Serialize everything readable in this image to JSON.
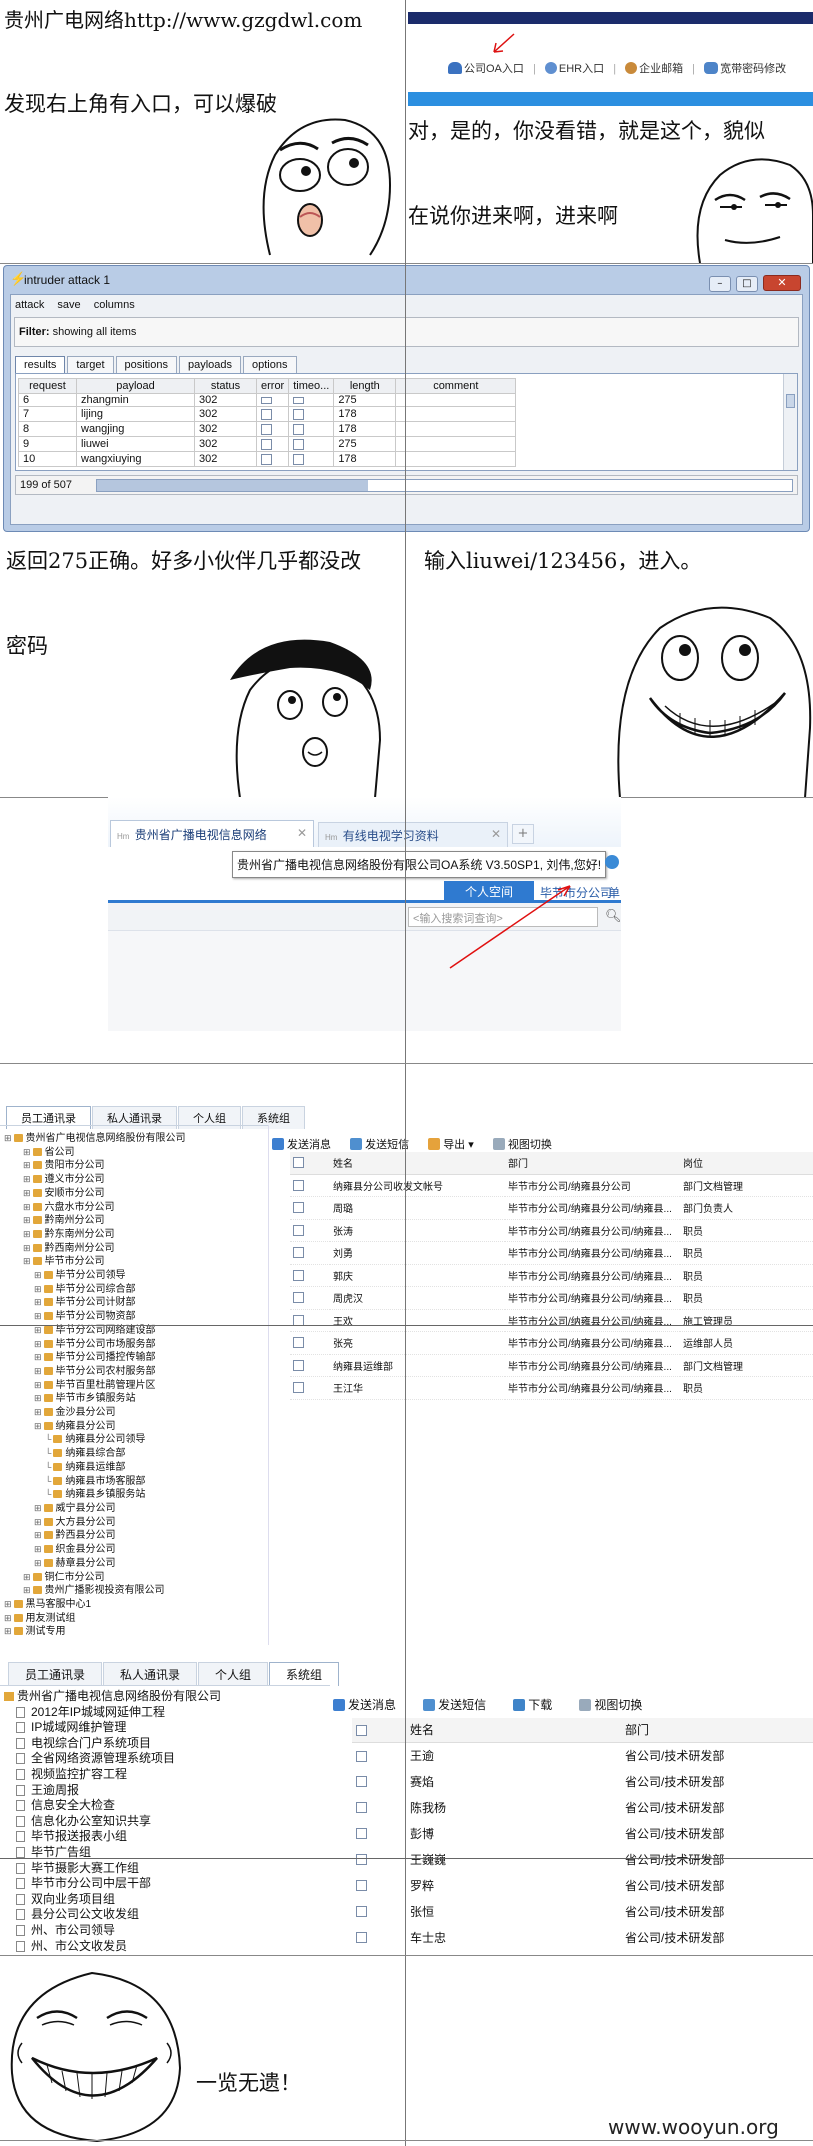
{
  "panel1": {
    "left_title": "贵州广电网络http://www.gzgdwl.com",
    "left_text": "发现右上角有入口，可以爆破",
    "right_text_1": "对，是的，你没看错，就是这个，貌似",
    "right_text_2": "在说你进来啊，进来啊",
    "topbar_links": [
      "公司OA入口",
      "EHR入口",
      "企业邮箱",
      "宽带密码修改"
    ]
  },
  "burp": {
    "window_title": "intruder attack 1",
    "menu": [
      "attack",
      "save",
      "columns"
    ],
    "filter_label": "Filter:",
    "filter_text": "showing all items",
    "tabs": [
      "results",
      "target",
      "positions",
      "payloads",
      "options"
    ],
    "columns": [
      "request",
      "payload",
      "status",
      "error",
      "timeo...",
      "length",
      "comment"
    ],
    "rows": [
      [
        "6",
        "zhangmin",
        "302",
        "275"
      ],
      [
        "7",
        "lijing",
        "302",
        "178"
      ],
      [
        "8",
        "wangjing",
        "302",
        "178"
      ],
      [
        "9",
        "liuwei",
        "302",
        "275"
      ],
      [
        "10",
        "wangxiuying",
        "302",
        "178"
      ]
    ],
    "status_text": "199 of 507"
  },
  "panel3": {
    "left_text_1": "返回275正确。好多小伙伴几乎都没改",
    "left_text_2": "密码",
    "right_text": "输入liuwei/123456，进入。"
  },
  "browser": {
    "tab1": "贵州省广播电视信息网络",
    "tab2": "有线电视学习资料",
    "welcome": "贵州省广播电视信息网络股份有限公司OA系统 V3.50SP1, 刘伟,您好!",
    "nav_tabs": [
      "个人空间",
      "毕节市分公司",
      "单"
    ],
    "search_placeholder": "<输入搜索词查询>"
  },
  "oa1": {
    "tabs": [
      "员工通讯录",
      "私人通讯录",
      "个人组",
      "系统组"
    ],
    "toolbar": [
      "发送消息",
      "发送短信",
      "导出",
      "视图切换"
    ],
    "tree": [
      {
        "d": 0,
        "t": "贵州省广电视信息网络股份有限公司"
      },
      {
        "d": 1,
        "t": "省公司"
      },
      {
        "d": 1,
        "t": "贵阳市分公司"
      },
      {
        "d": 1,
        "t": "遵义市分公司"
      },
      {
        "d": 1,
        "t": "安顺市分公司"
      },
      {
        "d": 1,
        "t": "六盘水市分公司"
      },
      {
        "d": 1,
        "t": "黔南州分公司"
      },
      {
        "d": 1,
        "t": "黔东南州分公司"
      },
      {
        "d": 1,
        "t": "黔西南州分公司"
      },
      {
        "d": 1,
        "t": "毕节市分公司"
      },
      {
        "d": 2,
        "t": "毕节分公司领导"
      },
      {
        "d": 2,
        "t": "毕节分公司综合部"
      },
      {
        "d": 2,
        "t": "毕节分公司计财部"
      },
      {
        "d": 2,
        "t": "毕节分公司物资部"
      },
      {
        "d": 2,
        "t": "毕节分公司网络建设部"
      },
      {
        "d": 2,
        "t": "毕节分公司市场服务部"
      },
      {
        "d": 2,
        "t": "毕节分公司播控传输部"
      },
      {
        "d": 2,
        "t": "毕节分公司农村服务部"
      },
      {
        "d": 2,
        "t": "毕节百里杜鹃管理片区"
      },
      {
        "d": 2,
        "t": "毕节市乡镇服务站"
      },
      {
        "d": 2,
        "t": "金沙县分公司"
      },
      {
        "d": 2,
        "t": "纳雍县分公司"
      },
      {
        "d": 3,
        "t": "纳雍县分公司领导"
      },
      {
        "d": 3,
        "t": "纳雍县综合部"
      },
      {
        "d": 3,
        "t": "纳雍县运维部"
      },
      {
        "d": 3,
        "t": "纳雍县市场客服部"
      },
      {
        "d": 3,
        "t": "纳雍县乡镇服务站"
      },
      {
        "d": 2,
        "t": "威宁县分公司"
      },
      {
        "d": 2,
        "t": "大方县分公司"
      },
      {
        "d": 2,
        "t": "黔西县分公司"
      },
      {
        "d": 2,
        "t": "织金县分公司"
      },
      {
        "d": 2,
        "t": "赫章县分公司"
      },
      {
        "d": 1,
        "t": "铜仁市分公司"
      },
      {
        "d": 1,
        "t": "贵州广播影视投资有限公司"
      },
      {
        "d": 0,
        "t": "黑马客服中心1"
      },
      {
        "d": 0,
        "t": "用友测试组"
      },
      {
        "d": 0,
        "t": "测试专用"
      }
    ],
    "columns": [
      "姓名",
      "部门",
      "岗位"
    ],
    "rows": [
      [
        "纳雍县分公司收发文帐号",
        "毕节市分公司/纳雍县分公司",
        "部门文档管理"
      ],
      [
        "周璐",
        "毕节市分公司/纳雍县分公司/纳雍县...",
        "部门负责人"
      ],
      [
        "张涛",
        "毕节市分公司/纳雍县分公司/纳雍县...",
        "职员"
      ],
      [
        "刘勇",
        "毕节市分公司/纳雍县分公司/纳雍县...",
        "职员"
      ],
      [
        "郭庆",
        "毕节市分公司/纳雍县分公司/纳雍县...",
        "职员"
      ],
      [
        "周虎汉",
        "毕节市分公司/纳雍县分公司/纳雍县...",
        "职员"
      ],
      [
        "王欢",
        "毕节市分公司/纳雍县分公司/纳雍县...",
        "施工管理员"
      ],
      [
        "张亮",
        "毕节市分公司/纳雍县分公司/纳雍县...",
        "运维部人员"
      ],
      [
        "纳雍县运维部",
        "毕节市分公司/纳雍县分公司/纳雍县...",
        "部门文档管理"
      ],
      [
        "王江华",
        "毕节市分公司/纳雍县分公司/纳雍县...",
        "职员"
      ]
    ]
  },
  "oa2": {
    "tabs": [
      "员工通讯录",
      "私人通讯录",
      "个人组",
      "系统组"
    ],
    "toolbar": [
      "发送消息",
      "发送短信",
      "下载",
      "视图切换"
    ],
    "tree": [
      {
        "d": 0,
        "t": "贵州省广播电视信息网络股份有限公司"
      },
      {
        "d": 1,
        "t": "2012年IP城域网延伸工程"
      },
      {
        "d": 1,
        "t": "IP城域网维护管理"
      },
      {
        "d": 1,
        "t": "电视综合门户系统项目"
      },
      {
        "d": 1,
        "t": "全省网络资源管理系统项目"
      },
      {
        "d": 1,
        "t": "视频监控扩容工程"
      },
      {
        "d": 1,
        "t": "王逾周报"
      },
      {
        "d": 1,
        "t": "信息安全大检查"
      },
      {
        "d": 1,
        "t": "信息化办公室知识共享"
      },
      {
        "d": 1,
        "t": "毕节报送报表小组"
      },
      {
        "d": 1,
        "t": "毕节广告组"
      },
      {
        "d": 1,
        "t": "毕节摄影大赛工作组"
      },
      {
        "d": 1,
        "t": "毕节市分公司中层干部"
      },
      {
        "d": 1,
        "t": "双向业务项目组"
      },
      {
        "d": 1,
        "t": "县分公司公文收发组"
      },
      {
        "d": 1,
        "t": "州、市公司领导"
      },
      {
        "d": 1,
        "t": "州、市公文收发员"
      }
    ],
    "columns": [
      "姓名",
      "部门"
    ],
    "rows": [
      [
        "王逾",
        "省公司/技术研发部"
      ],
      [
        "赛焰",
        "省公司/技术研发部"
      ],
      [
        "陈我杨",
        "省公司/技术研发部"
      ],
      [
        "彭博",
        "省公司/技术研发部"
      ],
      [
        "王巍巍",
        "省公司/技术研发部"
      ],
      [
        "罗粹",
        "省公司/技术研发部"
      ],
      [
        "张恒",
        "省公司/技术研发部"
      ],
      [
        "车士忠",
        "省公司/技术研发部"
      ]
    ]
  },
  "panel6": {
    "text": "一览无遗！",
    "watermark": "www.wooyun.org"
  }
}
